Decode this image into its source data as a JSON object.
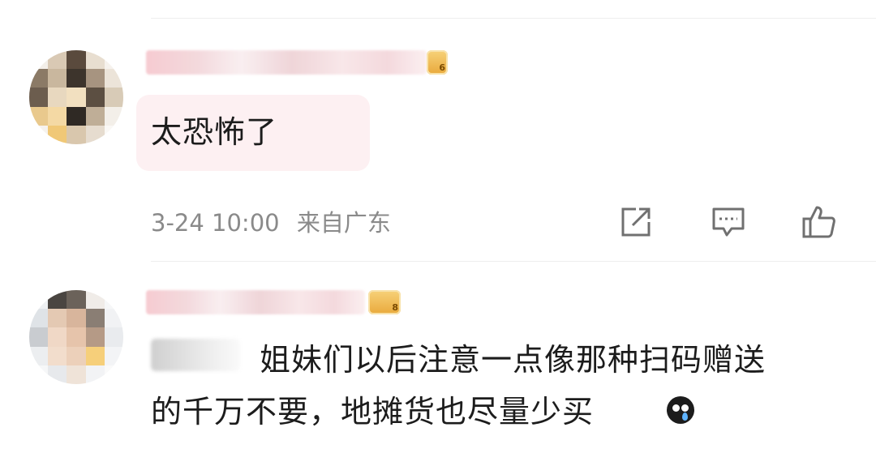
{
  "comments": [
    {
      "text": "太恐怖了",
      "timestamp": "3-24 10:00",
      "location": "来自广东",
      "badge_level": "6",
      "actions": [
        "share-icon",
        "comment-icon",
        "like-icon"
      ]
    },
    {
      "text_line1": "姐妹们以后注意一点像那种扫码赠送",
      "text_line2": "的千万不要，地摊货也尽量少买",
      "badge_level": "8",
      "emoji": "crying-emoji-icon"
    }
  ],
  "colors": {
    "bubble": "#fdf0f2",
    "meta_text": "#8a8a8a",
    "icon": "#707070"
  }
}
